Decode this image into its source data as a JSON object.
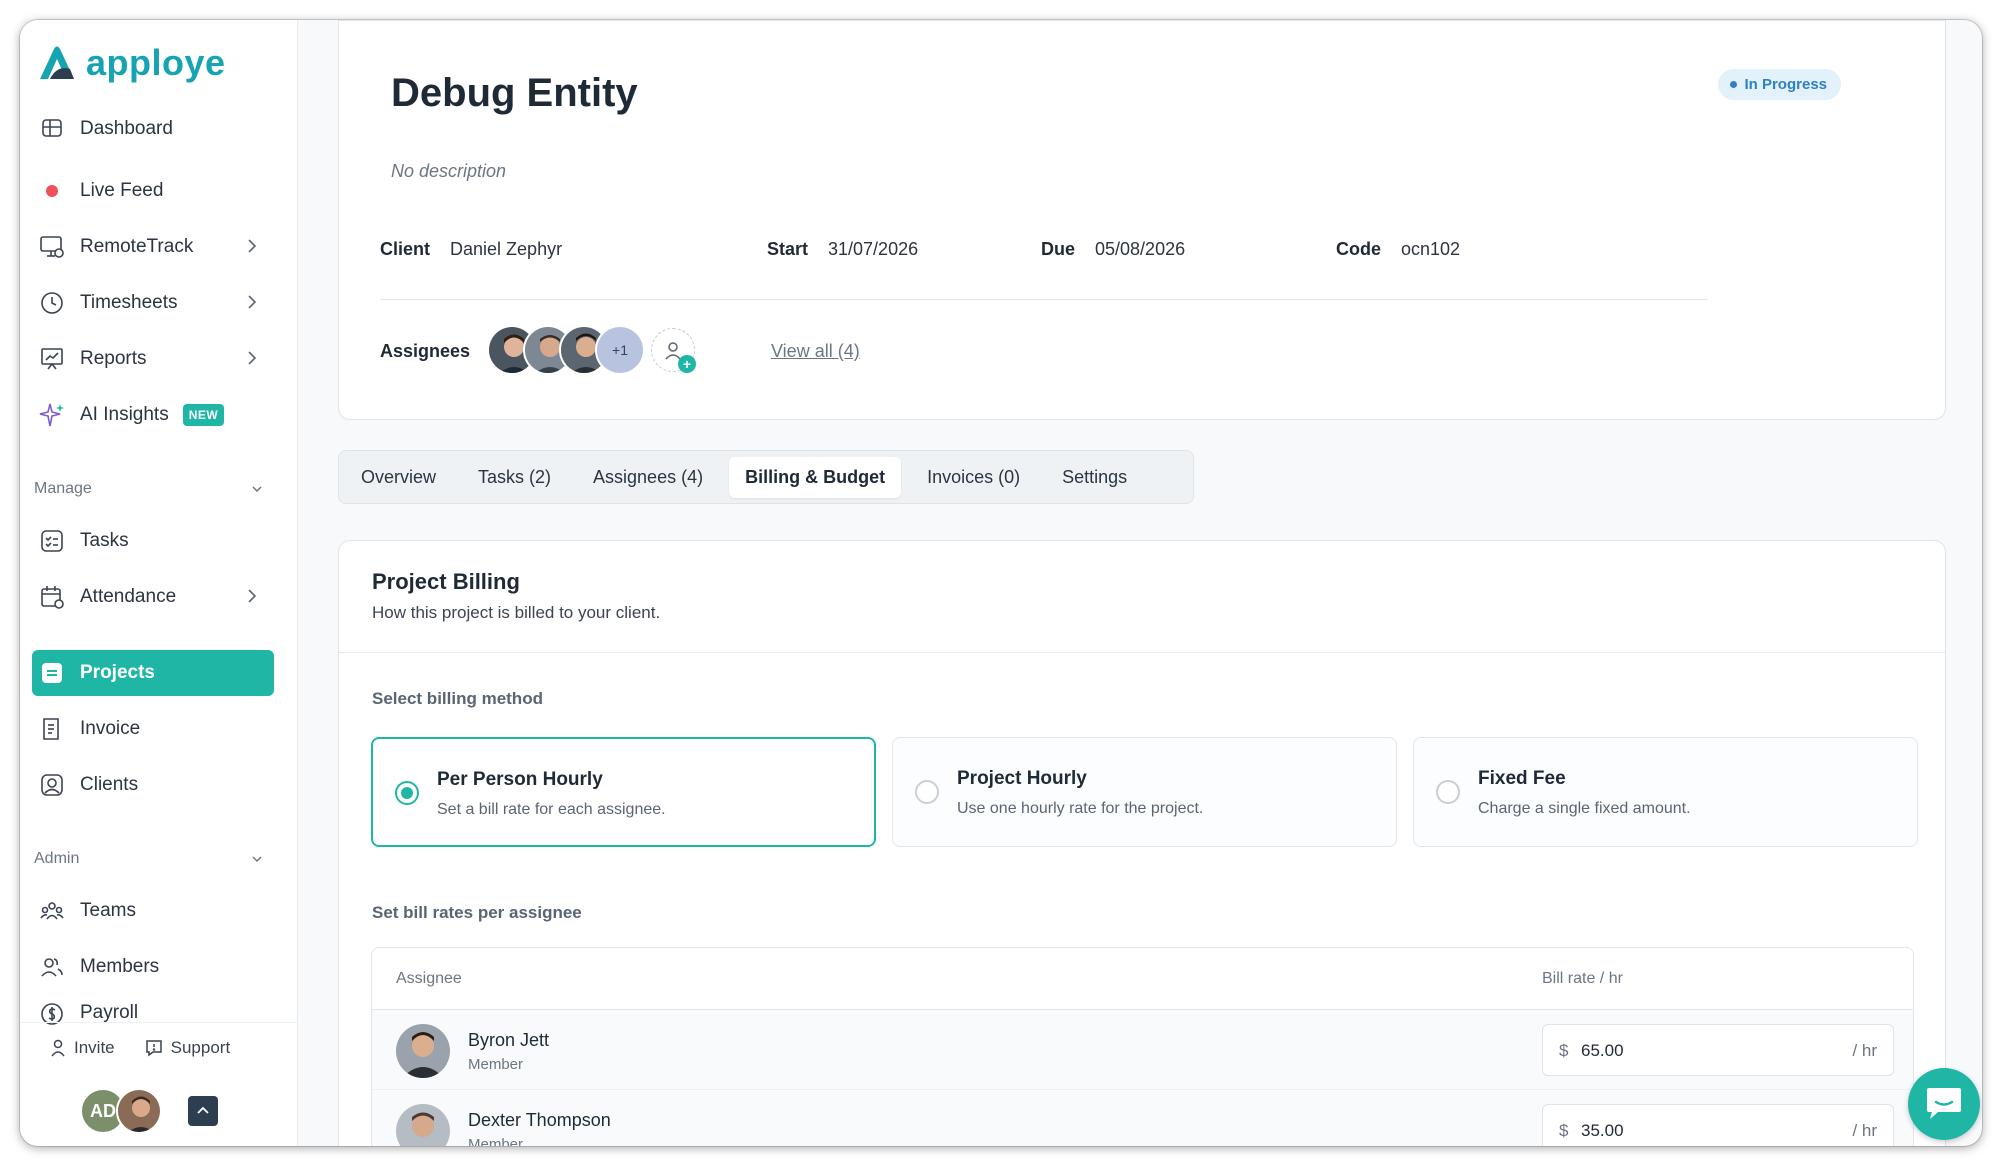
{
  "app": {
    "brand": "apploye",
    "accent_color": "#1fb6a6"
  },
  "sidebar": {
    "items_top": [
      {
        "label": "Dashboard",
        "icon": "dashboard-icon"
      },
      {
        "label": "Live Feed",
        "icon": "live-dot-icon"
      },
      {
        "label": "RemoteTrack",
        "icon": "monitor-icon"
      },
      {
        "label": "Timesheets",
        "icon": "clock-icon"
      },
      {
        "label": "Reports",
        "icon": "chart-icon"
      },
      {
        "label": "AI Insights",
        "icon": "sparkle-icon",
        "badge": "NEW"
      }
    ],
    "manage_label": "Manage",
    "manage_items": [
      {
        "label": "Tasks",
        "icon": "tasks-icon"
      },
      {
        "label": "Attendance",
        "icon": "calendar-icon"
      },
      {
        "label": "Projects",
        "icon": "projects-icon",
        "active": true
      },
      {
        "label": "Invoice",
        "icon": "invoice-icon"
      },
      {
        "label": "Clients",
        "icon": "clients-icon"
      }
    ],
    "admin_label": "Admin",
    "admin_items": [
      {
        "label": "Teams",
        "icon": "teams-icon"
      },
      {
        "label": "Members",
        "icon": "members-icon"
      },
      {
        "label": "Payroll",
        "icon": "payroll-icon"
      }
    ],
    "footer": {
      "invite": "Invite",
      "support": "Support"
    },
    "user": {
      "initials": "AD"
    }
  },
  "project": {
    "title": "Debug Entity",
    "status": "In Progress",
    "description": "No description",
    "client_label": "Client",
    "client": "Daniel Zephyr",
    "start_label": "Start",
    "start": "31/07/2026",
    "due_label": "Due",
    "due": "05/08/2026",
    "code_label": "Code",
    "code": "ocn102",
    "assignees_label": "Assignees",
    "assignees_more": "+1",
    "view_all": "View all (4)"
  },
  "tabs": [
    {
      "label": "Overview"
    },
    {
      "label": "Tasks (2)"
    },
    {
      "label": "Assignees (4)"
    },
    {
      "label": "Billing & Budget",
      "active": true
    },
    {
      "label": "Invoices (0)"
    },
    {
      "label": "Settings"
    }
  ],
  "billing": {
    "title": "Project Billing",
    "subtitle": "How this project is billed to your client.",
    "select_label": "Select billing method",
    "methods": [
      {
        "title": "Per Person Hourly",
        "desc": "Set a bill rate for each assignee.",
        "selected": true
      },
      {
        "title": "Project Hourly",
        "desc": "Use one hourly rate for the project."
      },
      {
        "title": "Fixed Fee",
        "desc": "Charge a single fixed amount."
      }
    ],
    "rates_label": "Set bill rates per assignee",
    "table": {
      "col_assignee": "Assignee",
      "col_rate": "Bill rate / hr",
      "currency": "$",
      "unit": "/ hr",
      "rows": [
        {
          "name": "Byron Jett",
          "role": "Member",
          "rate": "65.00"
        },
        {
          "name": "Dexter Thompson",
          "role": "Member",
          "rate": "35.00"
        }
      ]
    }
  }
}
